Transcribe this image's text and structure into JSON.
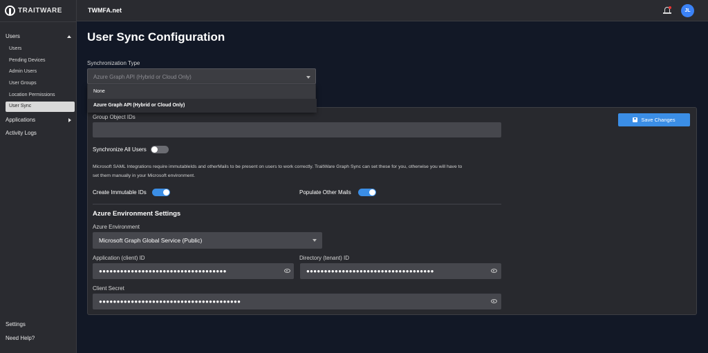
{
  "brand": {
    "logo_text": "TRAITWARE"
  },
  "topbar": {
    "org_name": "TWMFA.net",
    "avatar_initials": "JL"
  },
  "sidebar": {
    "users_label": "Users",
    "sub_items": [
      "Users",
      "Pending Devices",
      "Admin Users",
      "User Groups",
      "Location Permissions",
      "User Sync"
    ],
    "active_item": "User Sync",
    "applications_label": "Applications",
    "activity_logs_label": "Activity Logs",
    "settings_label": "Settings",
    "help_label": "Need Help?"
  },
  "page": {
    "title": "User Sync Configuration"
  },
  "sync_type": {
    "label": "Synchronization Type",
    "value": "Azure Graph API (Hybrid or Cloud Only)",
    "options": [
      "None",
      "Azure Graph API (Hybrid or Cloud Only)"
    ],
    "selected_option": "Azure Graph API (Hybrid or Cloud Only)"
  },
  "form": {
    "group_object_ids_label": "Group Object IDs",
    "group_object_ids_value": "",
    "save_label": "Save Changes",
    "sync_all_label": "Synchronize All Users",
    "sync_all_on": false,
    "note_line1": "Microsoft SAML Integrations require immutableIds and otherMails to be present on users to work correctly. TraitWare Graph Sync can set these for you, otherwise you will have to",
    "note_line2": "set them manually in your Microsoft environment.",
    "create_ids_label": "Create Immutable IDs",
    "create_ids_on": true,
    "populate_mails_label": "Populate Other Mails",
    "populate_mails_on": true
  },
  "azure": {
    "section_title": "Azure Environment Settings",
    "env_label": "Azure Environment",
    "env_value": "Microsoft Graph Global Service (Public)",
    "app_id_label": "Application (client) ID",
    "app_id_mask": "●●●●●●●●●●●●●●●●●●●●●●●●●●●●●●●●●●●●",
    "dir_id_label": "Directory (tenant) ID",
    "dir_id_mask": "●●●●●●●●●●●●●●●●●●●●●●●●●●●●●●●●●●●●",
    "secret_label": "Client Secret",
    "secret_mask": "●●●●●●●●●●●●●●●●●●●●●●●●●●●●●●●●●●●●●●●●"
  },
  "colors": {
    "accent": "#3b8ee6",
    "background": "#121826",
    "panel": "#28292e"
  },
  "icons": [
    "logo-mark-icon",
    "chevron-up-icon",
    "chevron-right-icon",
    "bell-icon",
    "chevron-down-icon",
    "save-icon",
    "eye-icon"
  ]
}
